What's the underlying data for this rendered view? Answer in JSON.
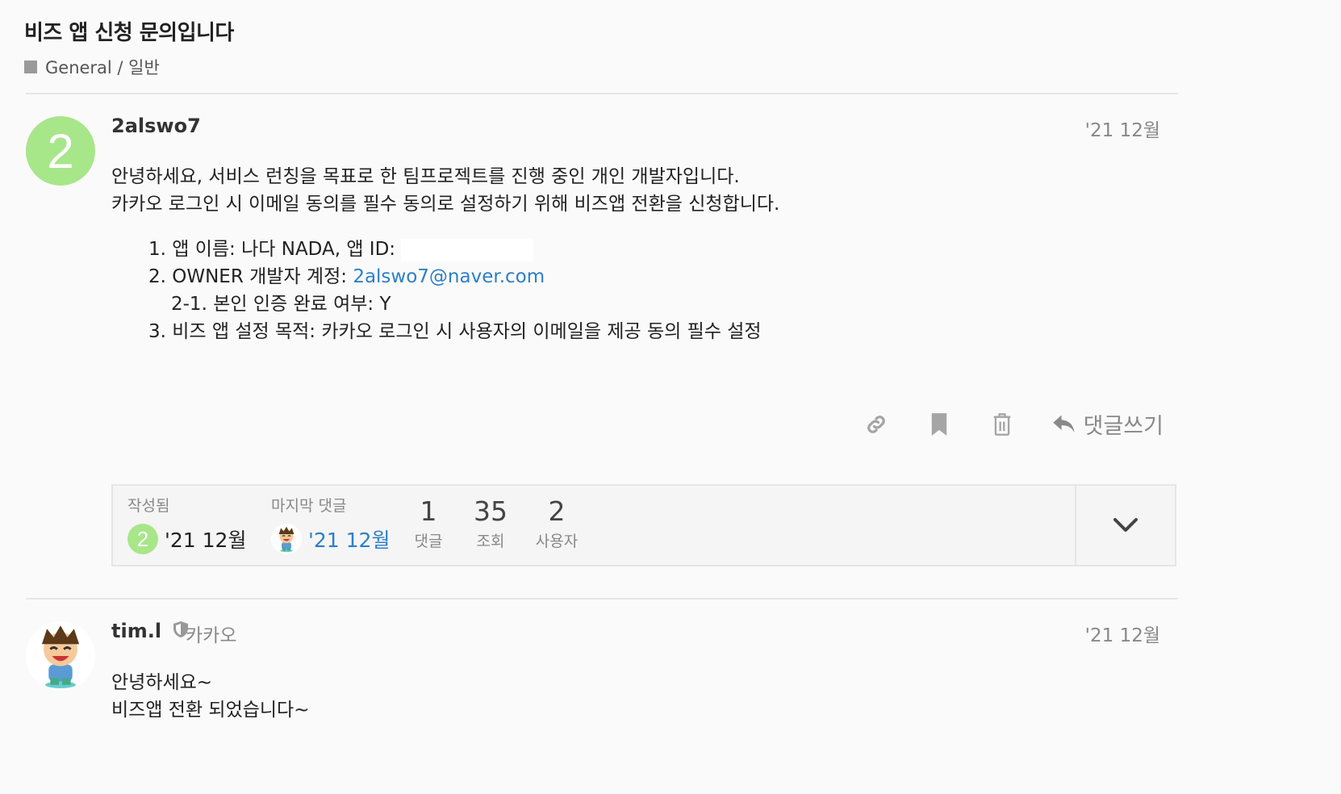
{
  "topic": {
    "title": "비즈 앱 신청 문의입니다",
    "category": "General / 일반"
  },
  "posts": [
    {
      "avatar_letter": "2",
      "username": "2alswo7",
      "date": "'21 12월",
      "paragraphs": [
        "안녕하세요, 서비스 런칭을 목표로 한 팀프로젝트를 진행 중인 개인 개발자입니다.",
        "카카오 로그인 시 이메일 동의를 필수 동의로 설정하기 위해 비즈앱 전환을 신청합니다."
      ],
      "list": {
        "item1": "1. 앱 이름: 나다 NADA, 앱 ID:",
        "item2_prefix": "2. OWNER 개발자 계정: ",
        "item2_email": "2alswo7@naver.com",
        "item2_sub": "2-1. 본인 인증 완료 여부: Y",
        "item3": "3. 비즈 앱 설정 목적: 카카오 로그인 시 사용자의 이메일을 제공 동의 필수 설정"
      },
      "actions": {
        "link_icon": "link-icon",
        "bookmark_icon": "bookmark-icon",
        "delete_icon": "trash-icon",
        "reply_label": "댓글쓰기"
      }
    },
    {
      "username": "tim.l",
      "user_title": "카카오",
      "date": "'21 12월",
      "paragraphs": [
        "안녕하세요~",
        "비즈앱 전환 되었습니다~"
      ]
    }
  ],
  "topic_map": {
    "created_label": "작성됨",
    "created_avatar_letter": "2",
    "created_date": "'21 12월",
    "last_reply_label": "마지막 댓글",
    "last_reply_date": "'21 12월",
    "replies_num": "1",
    "replies_label": "댓글",
    "views_num": "35",
    "views_label": "조회",
    "users_num": "2",
    "users_label": "사용자"
  },
  "colors": {
    "accent_link": "#2d7fc6",
    "avatar_green": "#a8e68a",
    "category_swatch": "#9a9a9a"
  }
}
